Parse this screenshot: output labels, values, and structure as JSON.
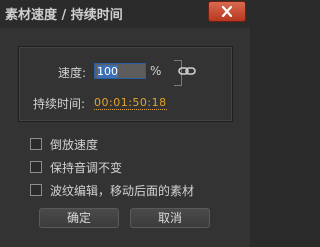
{
  "window": {
    "title": "素材速度 / 持续时间"
  },
  "speed": {
    "label": "速度:",
    "value": "100",
    "unit": "%"
  },
  "duration": {
    "label": "持续时间:",
    "value": "00:01:50:18"
  },
  "options": [
    {
      "label": "倒放速度",
      "checked": false
    },
    {
      "label": "保持音调不变",
      "checked": false
    },
    {
      "label": "波纹编辑，移动后面的素材",
      "checked": false
    }
  ],
  "buttons": {
    "ok": "确定",
    "cancel": "取消"
  },
  "icons": {
    "close": "close-icon",
    "link": "chain-link-icon"
  },
  "colors": {
    "timecode": "#e3a32d",
    "close_button": "#c9472e",
    "selection": "#3d6fb4"
  }
}
